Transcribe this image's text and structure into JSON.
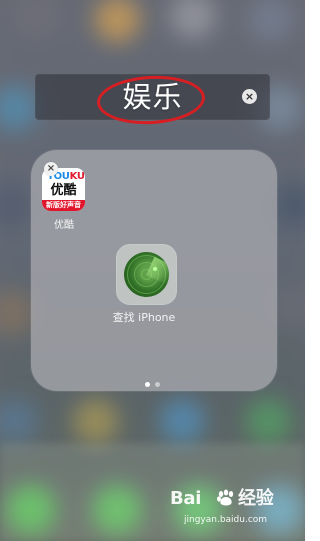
{
  "folder": {
    "title": "娱乐",
    "clear_icon": "close-icon",
    "page_count": 2,
    "current_page": 1
  },
  "apps": [
    {
      "name": "优酷",
      "icon": "youku-app-icon",
      "icon_text_en_1": "YOU",
      "icon_text_en_2": "KU",
      "icon_text_cn": "优酷",
      "icon_tag": "新版好声音",
      "delete_icon": "close-icon"
    },
    {
      "name": "查找 iPhone",
      "icon": "find-my-iphone-icon"
    }
  ],
  "watermark": {
    "brand": "Bai",
    "paw_icon": "baidu-paw-icon",
    "brand_suffix": "经验",
    "site": "jingyan.baidu.com"
  },
  "colors": {
    "highlight_circle": "#d71e22",
    "folder_bg": "#acacb2",
    "youku_blue": "#1b8ce5",
    "youku_red": "#e11b2e",
    "radar_green": "#2f6f26"
  }
}
